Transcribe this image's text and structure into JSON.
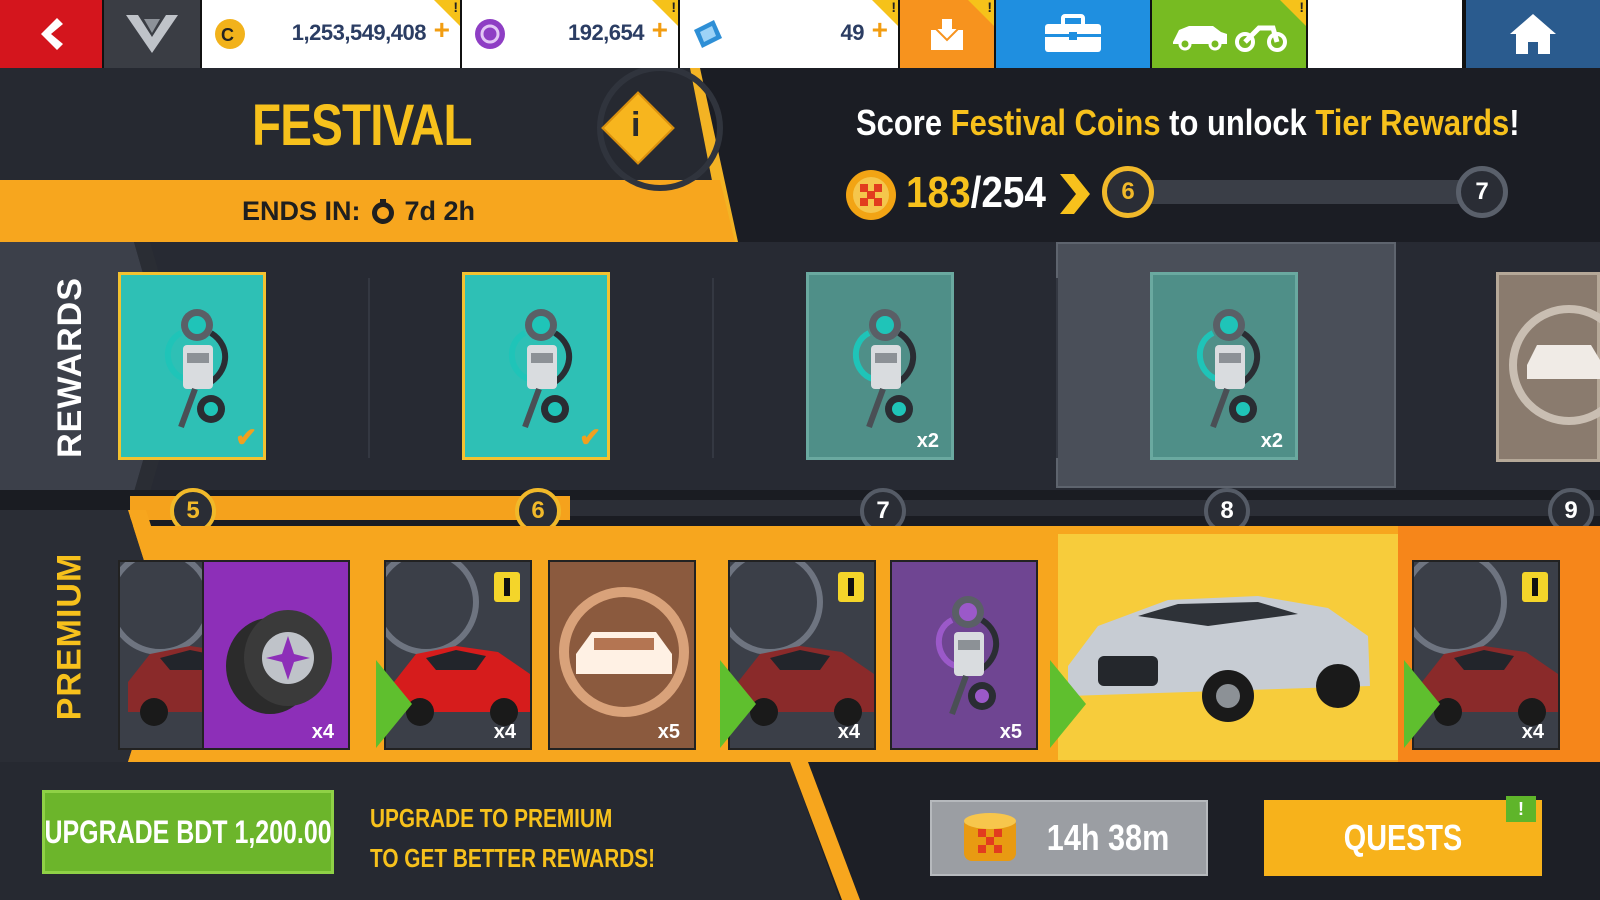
{
  "topbar": {
    "back_icon": "back-arrow-icon",
    "rank_icon": "rank-badge-icon",
    "credits": {
      "value": "1,253,549,408",
      "plus": "+",
      "icon": "credits-icon"
    },
    "tokens": {
      "value": "192,654",
      "plus": "+",
      "icon": "tokens-icon"
    },
    "blueprints": {
      "value": "49",
      "plus": "+",
      "icon": "blueprint-icon"
    },
    "inbox_icon": "inbox-icon",
    "toolbox_icon": "toolbox-icon",
    "garage_icon": "garage-icon",
    "home_icon": "home-icon"
  },
  "festival": {
    "title": "FESTIVAL",
    "info": "i",
    "ends_label": "ENDS IN:",
    "ends_value": "7d 2h"
  },
  "objective": {
    "prefix": "Score ",
    "highlight1": "Festival Coins",
    "middle": " to unlock ",
    "highlight2": "Tier Rewards",
    "suffix": "!",
    "coins_current": "183",
    "coins_total": "/254",
    "tier_current": "6",
    "tier_next": "7",
    "tier_progress": 0
  },
  "rows": {
    "rewards_label": "REWARDS",
    "premium_label": "PREMIUM"
  },
  "tiers": [
    "5",
    "6",
    "7",
    "8",
    "9"
  ],
  "tiers_completed": 2,
  "rewards": [
    {
      "count": "",
      "claimed": true
    },
    {
      "count": "",
      "claimed": true
    },
    {
      "count": "x2",
      "claimed": false
    },
    {
      "count": "x2",
      "claimed": false
    }
  ],
  "premium": [
    {
      "type": "ferrari",
      "count": "x4"
    },
    {
      "type": "tires",
      "count": "x4"
    },
    {
      "type": "ferrari",
      "count": "x4"
    },
    {
      "type": "car-bronze",
      "count": "x5"
    },
    {
      "type": "ferrari",
      "count": "x4"
    },
    {
      "type": "part",
      "count": "x5"
    },
    {
      "type": "jaguar",
      "count": ""
    },
    {
      "type": "ferrari",
      "count": "x4"
    }
  ],
  "bottom": {
    "upgrade_label": "UPGRADE BDT 1,200.00",
    "upgrade_text_line1": "UPGRADE TO PREMIUM",
    "upgrade_text_line2": "TO GET BETTER REWARDS!",
    "timer": "14h 38m",
    "quests_label": "QUESTS",
    "quests_badge": "!"
  },
  "colors": {
    "accent": "#f7a61e",
    "gold": "#f3c230",
    "green": "#6cb52b",
    "red": "#e0121b"
  }
}
